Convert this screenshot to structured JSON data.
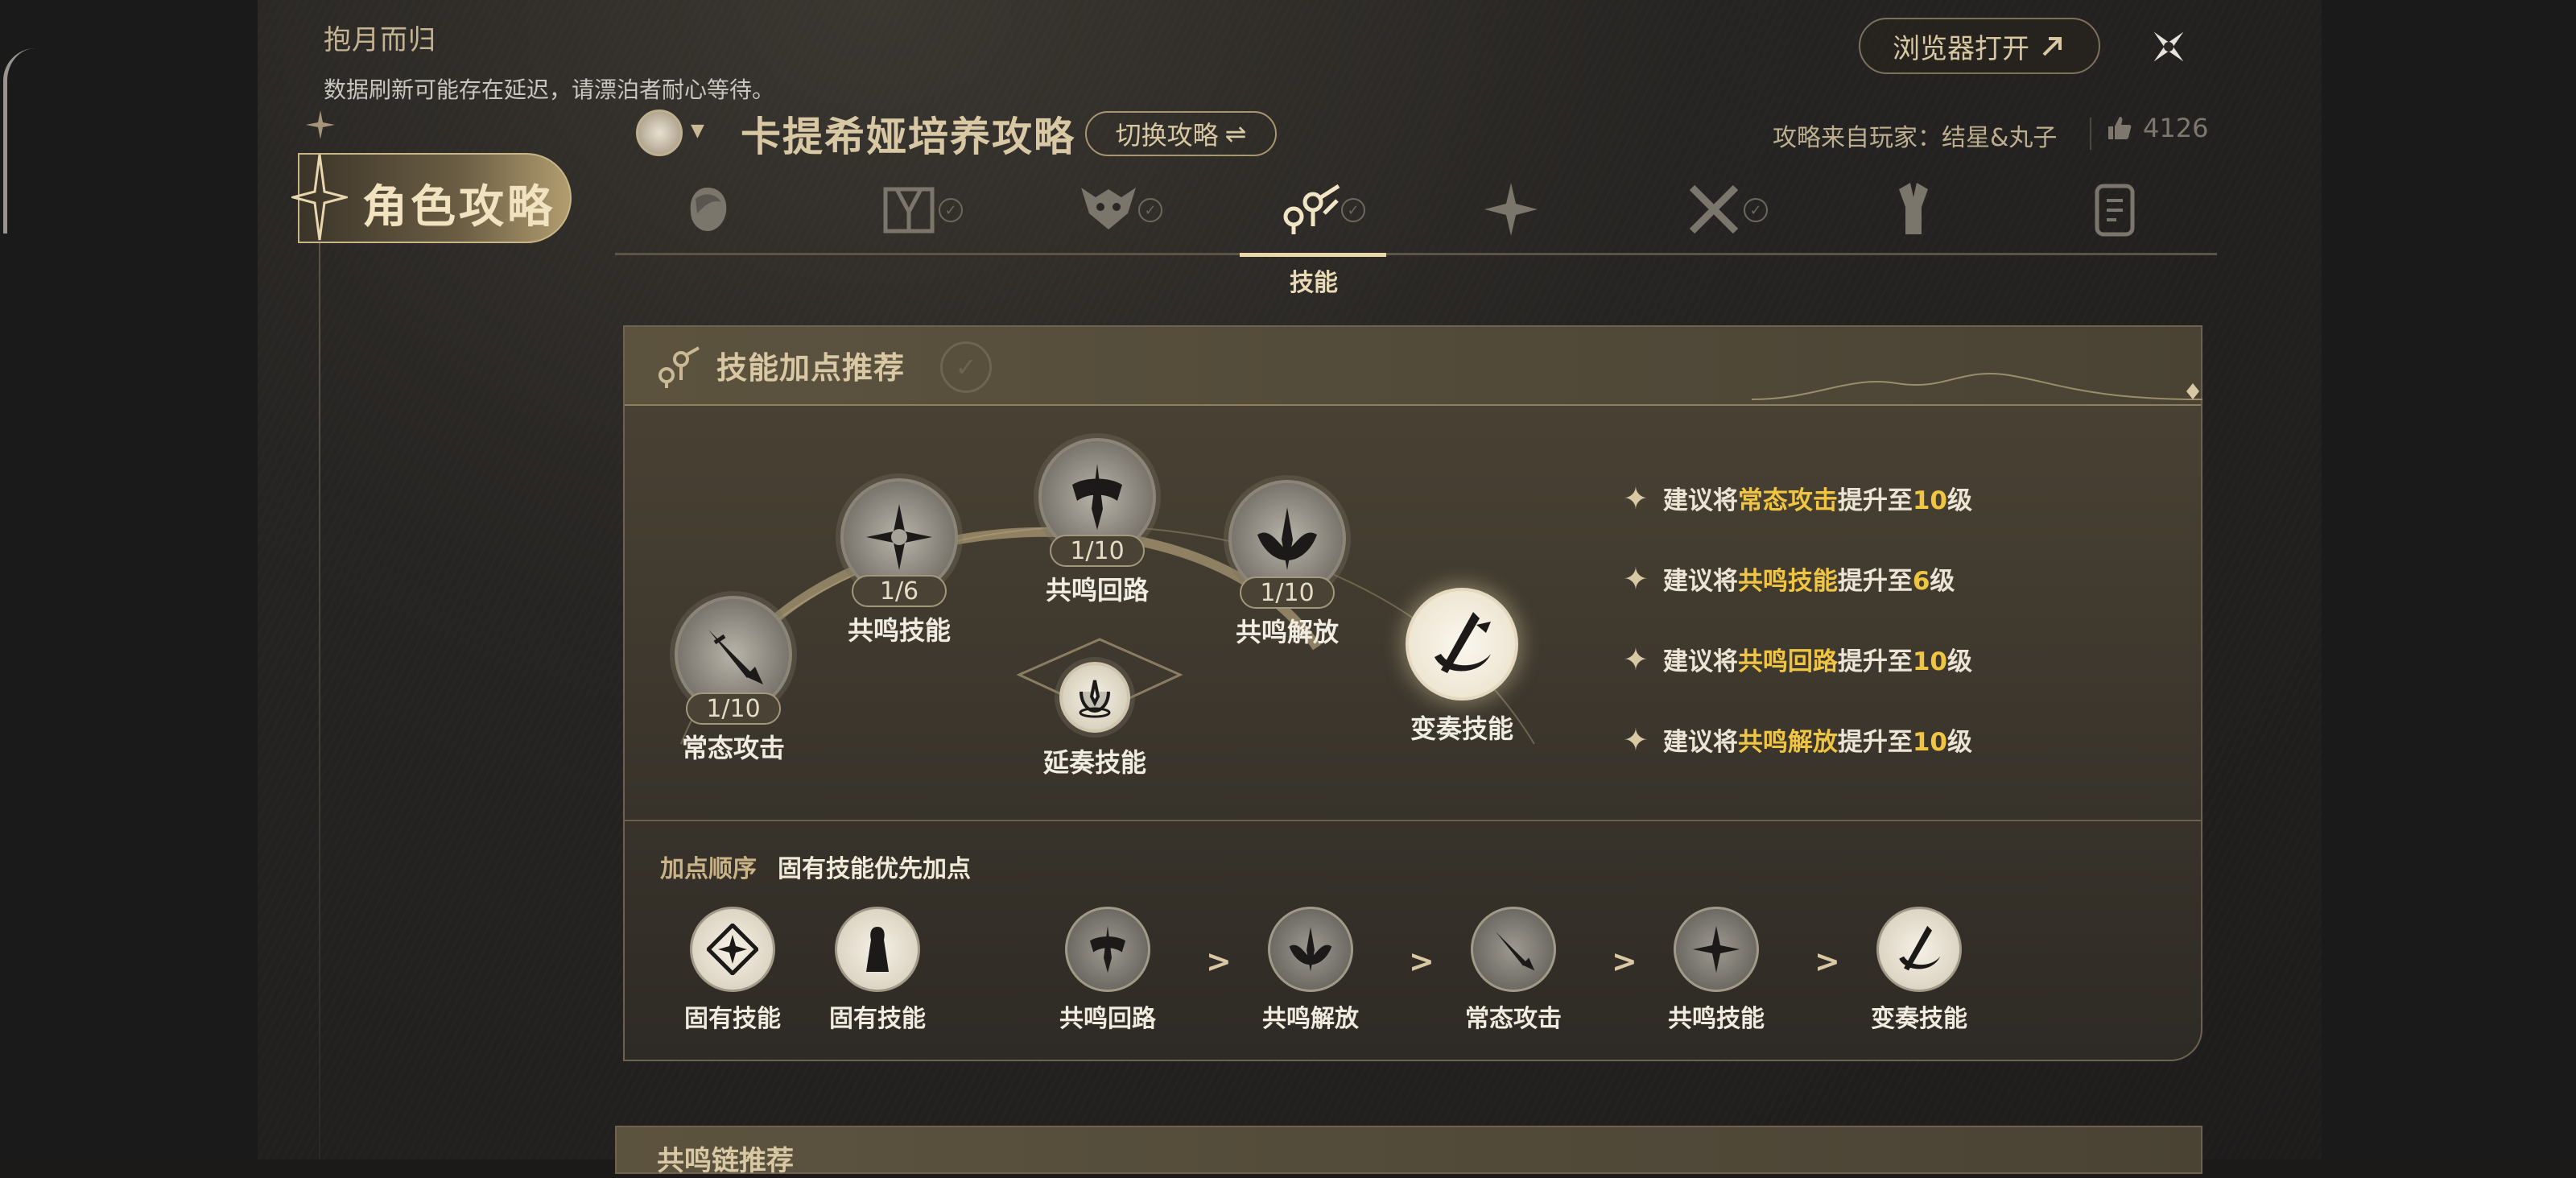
{
  "header": {
    "app_title": "抱月而归",
    "notice": "数据刷新可能存在延迟，请漂泊者耐心等待。",
    "browser_button": "浏览器打开",
    "close_icon": "close-icon"
  },
  "sidebar": {
    "active_tab": "角色攻略"
  },
  "guide": {
    "title": "卡提希娅培养攻略",
    "switch_button": "切换攻略",
    "author_prefix": "攻略来自玩家：",
    "author_name": "结星&丸子",
    "likes": "4126"
  },
  "tabs": [
    {
      "name": "character-icon",
      "checked": false
    },
    {
      "name": "weapon-gate-icon",
      "checked": true
    },
    {
      "name": "echo-mask-icon",
      "checked": true
    },
    {
      "name": "skill-chain-icon",
      "checked": true,
      "label": "技能",
      "active": true
    },
    {
      "name": "resonance-chain-icon",
      "checked": false
    },
    {
      "name": "crossed-swords-icon",
      "checked": true
    },
    {
      "name": "team-icon",
      "checked": false
    },
    {
      "name": "notes-icon",
      "checked": false
    }
  ],
  "skill_card": {
    "title": "技能加点推荐",
    "nodes": [
      {
        "name": "常态攻击",
        "level": "1/10"
      },
      {
        "name": "共鸣技能",
        "level": "1/6"
      },
      {
        "name": "共鸣回路",
        "level": "1/10"
      },
      {
        "name": "共鸣解放",
        "level": "1/10"
      },
      {
        "name": "延奏技能"
      },
      {
        "name": "变奏技能"
      }
    ],
    "recommendations": [
      {
        "prefix": "建议将",
        "skill": "常态攻击",
        "middle": "提升至",
        "level": "10",
        "suffix": "级"
      },
      {
        "prefix": "建议将",
        "skill": "共鸣技能",
        "middle": "提升至",
        "level": "6",
        "suffix": "级"
      },
      {
        "prefix": "建议将",
        "skill": "共鸣回路",
        "middle": "提升至",
        "level": "10",
        "suffix": "级"
      },
      {
        "prefix": "建议将",
        "skill": "共鸣解放",
        "middle": "提升至",
        "level": "10",
        "suffix": "级"
      }
    ],
    "order_label": "加点顺序",
    "order_value": "固有技能优先加点",
    "order": [
      {
        "name": "固有技能"
      },
      {
        "name": "固有技能"
      },
      {
        "name": "共鸣回路"
      },
      {
        "name": "共鸣解放"
      },
      {
        "name": "常态攻击"
      },
      {
        "name": "共鸣技能"
      },
      {
        "name": "变奏技能"
      }
    ],
    "order_arrow": ">"
  },
  "next_card": {
    "title": "共鸣链推荐"
  },
  "colors": {
    "accent_gold": "#d8c9a4",
    "highlight": "#f0c542",
    "panel_bg": "#2a2724"
  }
}
